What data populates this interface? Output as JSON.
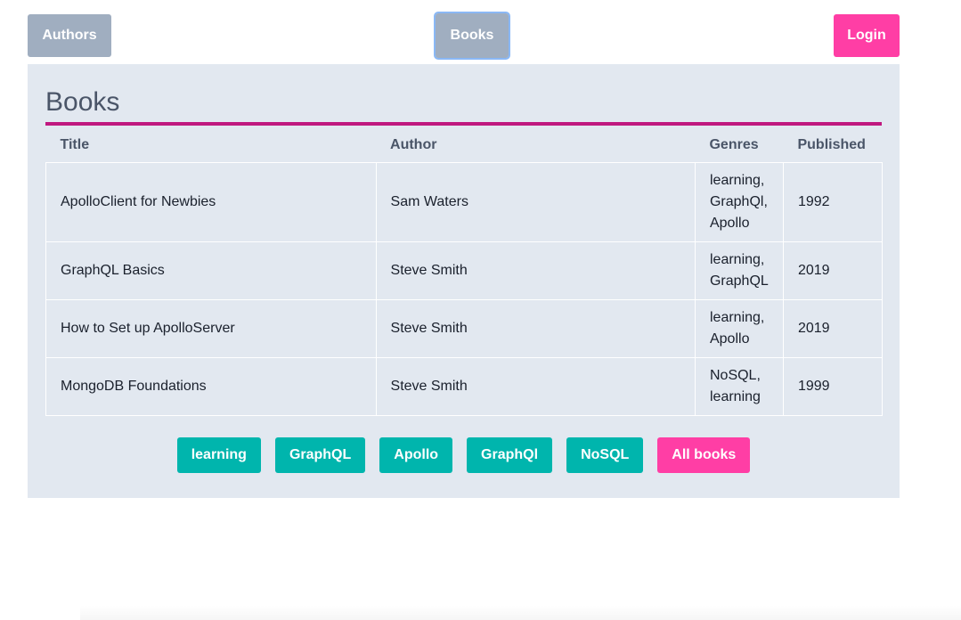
{
  "nav": {
    "authors_label": "Authors",
    "books_label": "Books",
    "login_label": "Login"
  },
  "panel": {
    "title": "Books"
  },
  "table": {
    "headers": [
      "Title",
      "Author",
      "Genres",
      "Published"
    ],
    "rows": [
      {
        "title": "ApolloClient for Newbies",
        "author": "Sam Waters",
        "genres": [
          "learning,",
          "GraphQl,",
          "Apollo"
        ],
        "published": "1992"
      },
      {
        "title": "GraphQL Basics",
        "author": "Steve Smith",
        "genres": [
          "learning,",
          "GraphQL"
        ],
        "published": "2019"
      },
      {
        "title": "How to Set up ApolloServer",
        "author": "Steve Smith",
        "genres": [
          "learning,",
          "Apollo"
        ],
        "published": "2019"
      },
      {
        "title": "MongoDB Foundations",
        "author": "Steve Smith",
        "genres": [
          "NoSQL,",
          "learning"
        ],
        "published": "1999"
      }
    ]
  },
  "filters": {
    "genres": [
      "learning",
      "GraphQL",
      "Apollo",
      "GraphQl",
      "NoSQL"
    ],
    "all_label": "All books"
  },
  "colors": {
    "nav_gray": "#a0aec0",
    "accent_pink": "#ff3ea5",
    "teal": "#00b5ad",
    "rule_magenta": "#c0187f",
    "panel_bg": "#e2e8f0"
  }
}
